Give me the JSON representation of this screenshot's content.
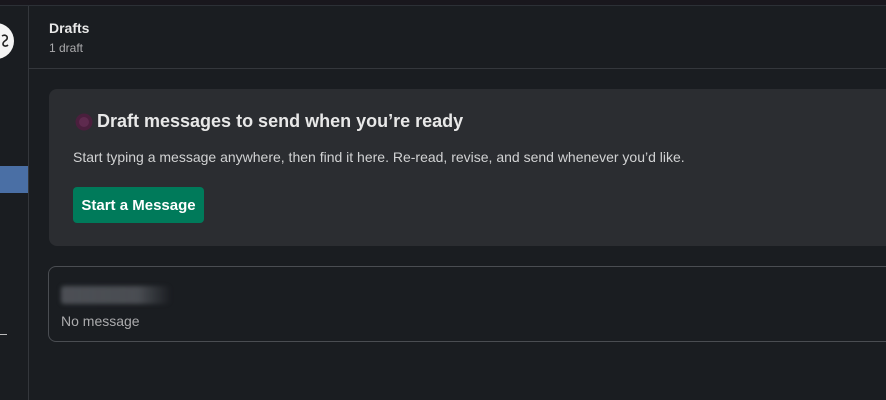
{
  "header": {
    "title": "Drafts",
    "subtitle": "1 draft"
  },
  "promo": {
    "icon": "draft-icon",
    "title": "Draft messages to send when you’re ready",
    "description": "Start typing a message anywhere, then find it here. Re-read, revise, and send whenever you’d like.",
    "button_label": "Start a Message"
  },
  "drafts": [
    {
      "recipient": "",
      "preview": "No message"
    }
  ],
  "colors": {
    "background": "#1a1d21",
    "card": "#2b2d31",
    "accent": "#007a5a",
    "sidebar_active": "#4a6fa5"
  }
}
